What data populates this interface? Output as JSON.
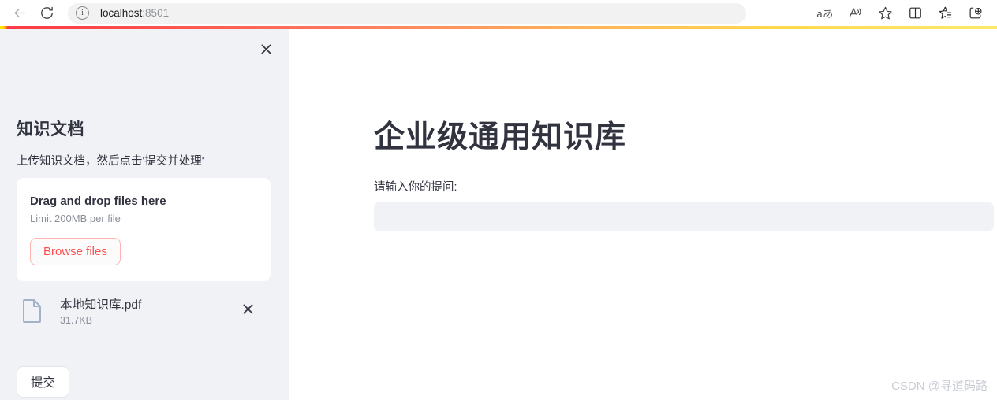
{
  "browser": {
    "back_label": "Back",
    "reload_label": "Refresh",
    "site_info_glyph": "i",
    "url_host": "localhost",
    "url_port": ":8501",
    "url_full": "localhost:8501",
    "toolbar": [
      {
        "name": "translate-icon",
        "glyph": "aあ",
        "label": "Translate"
      },
      {
        "name": "read-aloud-icon",
        "label": "Read aloud"
      },
      {
        "name": "favorite-star-icon",
        "label": "Add this page to favorites"
      },
      {
        "name": "split-screen-icon",
        "label": "Split screen"
      },
      {
        "name": "collections-icon",
        "label": "Collections"
      },
      {
        "name": "add-tab-icon",
        "label": "Add to tab group"
      }
    ]
  },
  "accent": {
    "gradient_start": "#ff4b4b",
    "gradient_end": "#ffe96b",
    "primary_red": "#ff4b4b",
    "sidebar_bg": "#f0f2f6",
    "text": "#31333f"
  },
  "sidebar": {
    "close_label": "×",
    "title": "知识文档",
    "description": "上传知识文档，然后点击'提交并处理'",
    "uploader": {
      "title": "Drag and drop files here",
      "limit": "Limit 200MB per file",
      "browse_label": "Browse files"
    },
    "file": {
      "name": "本地知识库.pdf",
      "size": "31.7KB",
      "remove_label": "×"
    },
    "submit_label": "提交"
  },
  "main": {
    "title": "企业级通用知识库",
    "question_label": "请输入你的提问:",
    "question_value": "",
    "question_placeholder": "",
    "watermark": "CSDN @寻道码路"
  }
}
